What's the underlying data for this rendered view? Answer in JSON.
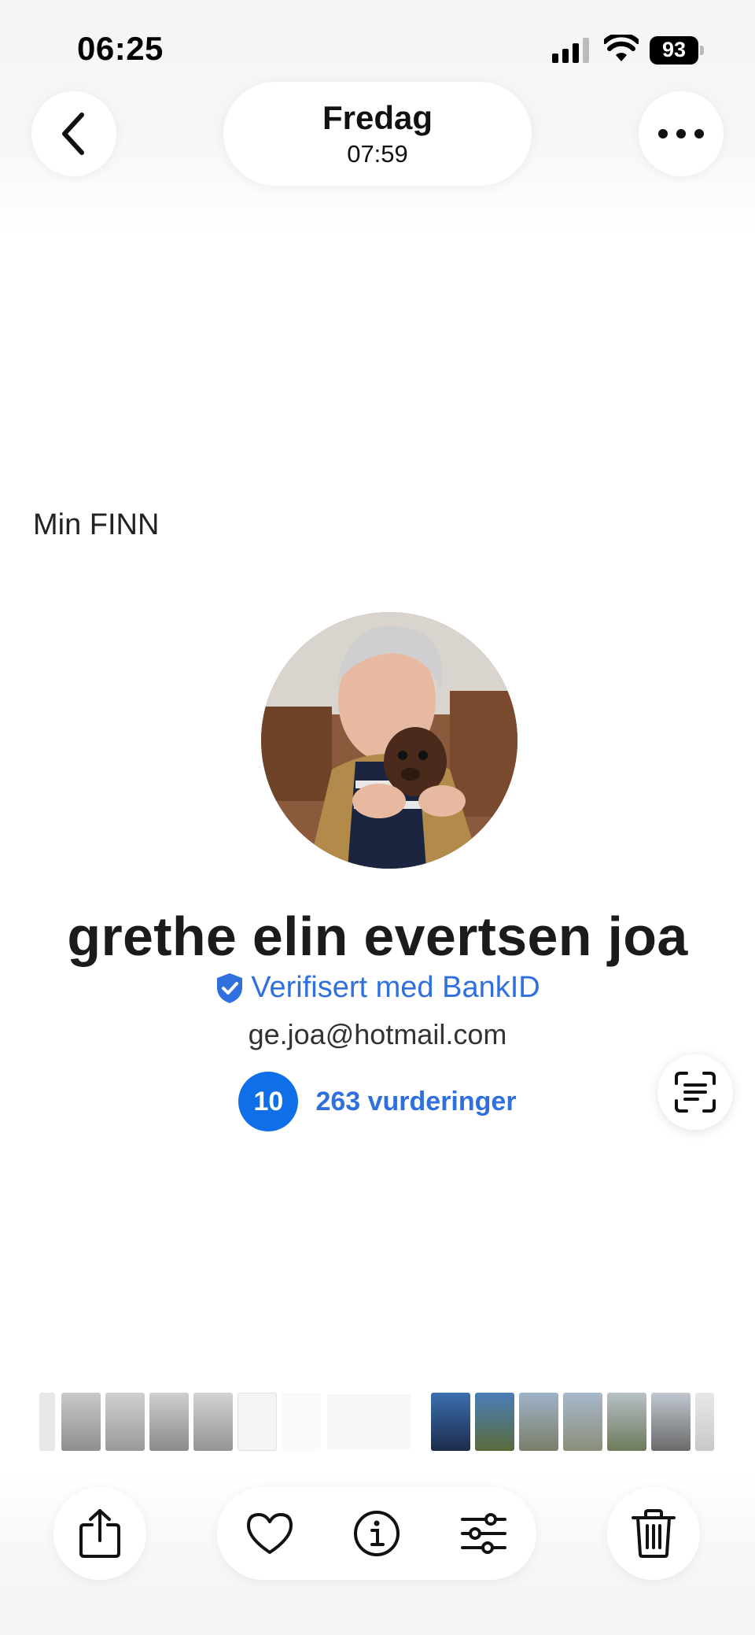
{
  "status_bar": {
    "time": "06:25",
    "battery": "93"
  },
  "header": {
    "day": "Fredag",
    "time": "07:59",
    "back_icon": "chevron-left-icon",
    "more_icon": "ellipsis-icon"
  },
  "screenshot": {
    "section_label": "Min FINN",
    "profile": {
      "name": "grethe elin evertsen joa",
      "verified_text": "Verifisert med BankID",
      "email": "ge.joa@hotmail.com",
      "rating_score": "10",
      "rating_count": "263 vurderinger"
    }
  },
  "toolbar": {
    "share_icon": "share-icon",
    "favorite_icon": "heart-icon",
    "info_icon": "info-icon",
    "adjust_icon": "sliders-icon",
    "delete_icon": "trash-icon",
    "scan_icon": "live-text-icon"
  },
  "colors": {
    "accent_blue": "#2f6fde",
    "badge_blue": "#0f6fe8",
    "background": "#ffffff"
  }
}
